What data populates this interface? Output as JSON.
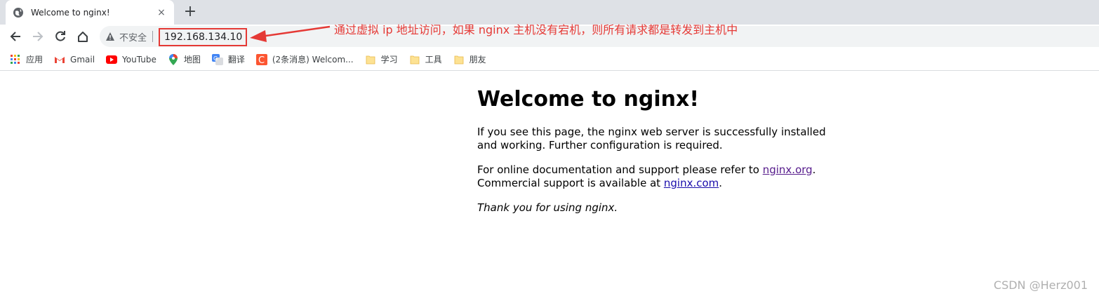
{
  "tab": {
    "title": "Welcome to nginx!",
    "favicon": "globe-icon",
    "close": "×"
  },
  "new_tab": "+",
  "toolbar": {
    "security_label": "不安全",
    "url": "192.168.134.10"
  },
  "annotation": "通过虚拟 ip 地址访问，如果 nginx 主机没有宕机，则所有请求都是转发到主机中",
  "bookmarks": [
    {
      "label": "应用",
      "icon": "apps-grid-icon"
    },
    {
      "label": "Gmail",
      "icon": "gmail-icon"
    },
    {
      "label": "YouTube",
      "icon": "youtube-icon"
    },
    {
      "label": "地图",
      "icon": "maps-pin-icon"
    },
    {
      "label": "翻译",
      "icon": "translate-icon"
    },
    {
      "label": "(2条消息) Welcom...",
      "icon": "csdn-icon"
    },
    {
      "label": "学习",
      "icon": "folder-icon"
    },
    {
      "label": "工具",
      "icon": "folder-icon"
    },
    {
      "label": "朋友",
      "icon": "folder-icon"
    }
  ],
  "page": {
    "heading": "Welcome to nginx!",
    "para1": "If you see this page, the nginx web server is successfully installed and working. Further configuration is required.",
    "para2_prefix": "For online documentation and support please refer to ",
    "link_org": "nginx.org",
    "para2_mid": ".",
    "para2_line2_prefix": "Commercial support is available at ",
    "link_com": "nginx.com",
    "para2_end": ".",
    "thanks": "Thank you for using nginx."
  },
  "watermark": "CSDN @Herz001",
  "colors": {
    "annotation": "#e53935",
    "link": "#1a0dab",
    "visited_link": "#551a8b"
  }
}
